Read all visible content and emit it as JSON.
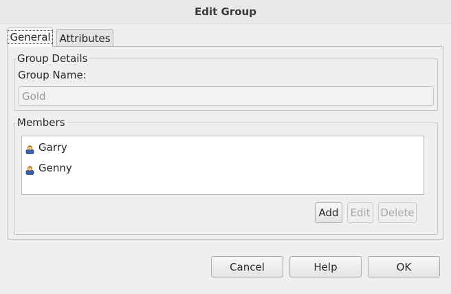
{
  "window": {
    "title": "Edit Group"
  },
  "tabs": [
    {
      "label": "General",
      "active": true
    },
    {
      "label": "Attributes",
      "active": false
    }
  ],
  "group_details": {
    "legend": "Group Details",
    "name_label": "Group Name:",
    "name_value": "Gold"
  },
  "members": {
    "legend": "Members",
    "items": [
      {
        "name": "Garry",
        "icon": "user-icon"
      },
      {
        "name": "Genny",
        "icon": "user-icon"
      }
    ],
    "add_label": "Add",
    "edit_label": "Edit",
    "delete_label": "Delete"
  },
  "footer": {
    "cancel_label": "Cancel",
    "help_label": "Help",
    "ok_label": "OK"
  },
  "colors": {
    "window_bg": "#efefef",
    "list_bg": "#ffffff",
    "disabled_text": "#a8a8a8"
  }
}
